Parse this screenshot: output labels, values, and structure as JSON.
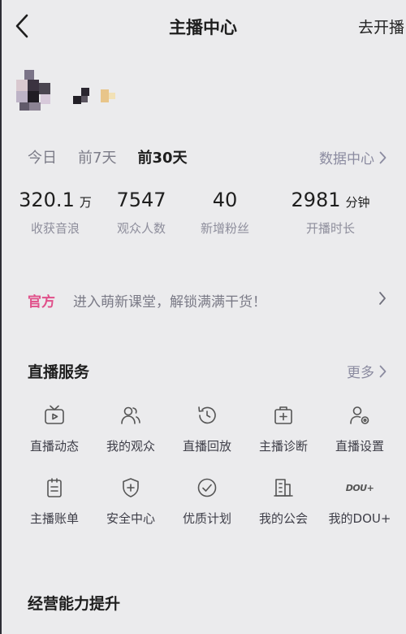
{
  "header": {
    "title": "主播中心",
    "go_live_label": "去开播"
  },
  "period_tabs": [
    {
      "label": "今日"
    },
    {
      "label": "前7天"
    },
    {
      "label": "前30天"
    }
  ],
  "active_tab": "前30天",
  "data_center_label": "数据中心",
  "stats": [
    {
      "value": "320.1",
      "unit": "万",
      "label": "收获音浪"
    },
    {
      "value": "7547",
      "unit": "",
      "label": "观众人数"
    },
    {
      "value": "40",
      "unit": "",
      "label": "新增粉丝"
    },
    {
      "value": "2981",
      "unit": "分钟",
      "label": "开播时长"
    }
  ],
  "banner": {
    "tag": "官方",
    "text": "进入萌新课堂，解锁满满干货！"
  },
  "services": {
    "title": "直播服务",
    "more_label": "更多",
    "items": [
      {
        "label": "直播动态",
        "icon": "tv-icon"
      },
      {
        "label": "我的观众",
        "icon": "users-icon"
      },
      {
        "label": "直播回放",
        "icon": "replay-clock-icon"
      },
      {
        "label": "主播诊断",
        "icon": "medical-kit-icon"
      },
      {
        "label": "直播设置",
        "icon": "user-settings-icon"
      },
      {
        "label": "主播账单",
        "icon": "bill-icon"
      },
      {
        "label": "安全中心",
        "icon": "shield-plus-icon"
      },
      {
        "label": "优质计划",
        "icon": "check-circle-icon"
      },
      {
        "label": "我的公会",
        "icon": "building-icon"
      },
      {
        "label": "我的DOU+",
        "icon": "dou-plus-icon",
        "glyph": "DOU+"
      }
    ]
  },
  "business": {
    "title": "经营能力提升"
  },
  "colors": {
    "background": "#ebebed",
    "accent_pink": "#e0508a",
    "muted_text": "#8b8ba0"
  }
}
